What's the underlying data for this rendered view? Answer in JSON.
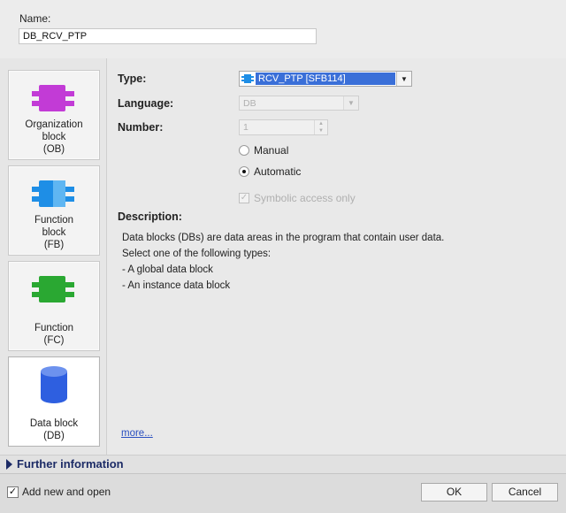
{
  "name_field": {
    "label": "Name:",
    "value": "DB_RCV_PTP"
  },
  "sidebar": {
    "items": [
      {
        "line1": "Organization",
        "line2": "block",
        "line3": "(OB)",
        "color": "#c23bd6"
      },
      {
        "line1": "Function",
        "line2": "block",
        "line3": "(FB)",
        "color": "#1e8ee6"
      },
      {
        "line1": "Function",
        "line2": "(FC)",
        "color": "#2aa832"
      },
      {
        "line1": "Data block",
        "line2": "(DB)",
        "color": "#2e5fe0"
      }
    ]
  },
  "form": {
    "type_label": "Type:",
    "type_value": "RCV_PTP [SFB114]",
    "language_label": "Language:",
    "language_value": "DB",
    "number_label": "Number:",
    "number_value": "1",
    "manual_label": "Manual",
    "automatic_label": "Automatic",
    "symbolic_label": "Symbolic access only"
  },
  "description": {
    "label": "Description:",
    "lines": [
      "Data blocks (DBs) are data areas in the program that contain user data.",
      "Select one of the following types:",
      "- A global data block",
      "- An instance data block"
    ],
    "more_link": "more..."
  },
  "further_info": "Further information",
  "footer": {
    "add_new_label": "Add new and open",
    "ok_label": "OK",
    "cancel_label": "Cancel"
  },
  "colors": {
    "selection": "#3a6fd8",
    "link": "#2a4fc0",
    "further_text": "#1c2b66"
  }
}
